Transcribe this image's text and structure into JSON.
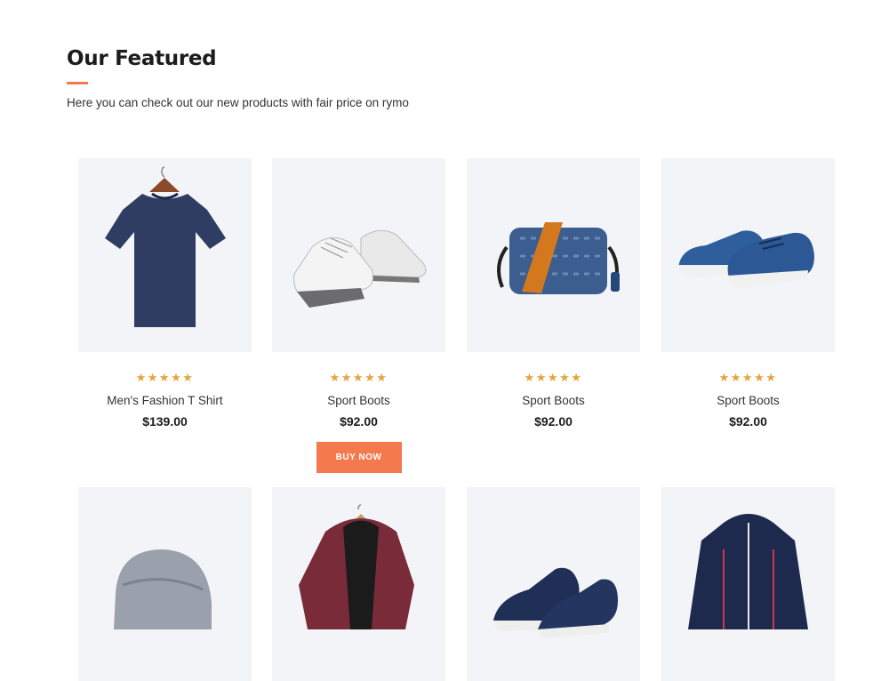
{
  "section": {
    "title": "Our Featured",
    "subtitle": "Here you can check out our new products with fair price on rymo"
  },
  "products_row1": [
    {
      "name": "Men's Fashion T Shirt",
      "price": "$139.00",
      "rating": 5,
      "stars": "★★★★★",
      "icon": "tshirt-image"
    },
    {
      "name": "Sport Boots",
      "price": "$92.00",
      "rating": 5,
      "stars": "★★★★★",
      "icon": "sneakers-image",
      "button": "BUY NOW"
    },
    {
      "name": "Sport Boots",
      "price": "$92.00",
      "rating": 5,
      "stars": "★★★★★",
      "icon": "crossbody-bag-image"
    },
    {
      "name": "Sport Boots",
      "price": "$92.00",
      "rating": 5,
      "stars": "★★★★★",
      "icon": "blue-shoes-image"
    }
  ],
  "products_row2": [
    {
      "icon": "beanie-image"
    },
    {
      "icon": "hooded-coat-image"
    },
    {
      "icon": "navy-sneakers-image"
    },
    {
      "icon": "puffer-jacket-image"
    }
  ],
  "colors": {
    "accent": "#f47a4d",
    "stars": "#e6a23c",
    "card_bg": "#f3f4f7"
  }
}
